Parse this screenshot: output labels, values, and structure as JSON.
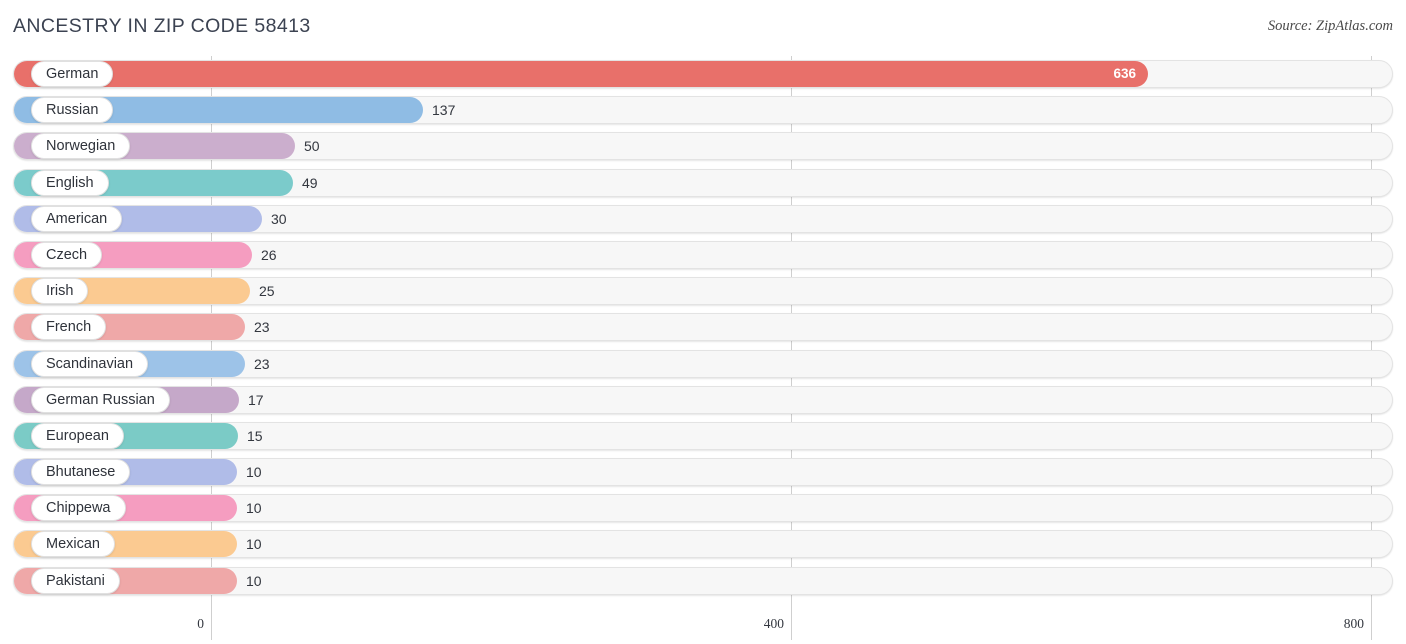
{
  "header": {
    "title": "ANCESTRY IN ZIP CODE 58413",
    "source": "Source: ZipAtlas.com"
  },
  "chart_data": {
    "type": "bar",
    "orientation": "horizontal",
    "title": "ANCESTRY IN ZIP CODE 58413",
    "xlabel": "",
    "ylabel": "",
    "xlim": [
      0,
      800
    ],
    "grid": true,
    "legend": "none",
    "xticks": [
      0,
      400,
      800
    ],
    "xtick_labels": [
      "0",
      "400",
      "800"
    ],
    "categories": [
      "German",
      "Russian",
      "Norwegian",
      "English",
      "American",
      "Czech",
      "Irish",
      "French",
      "Scandinavian",
      "German Russian",
      "European",
      "Bhutanese",
      "Chippewa",
      "Mexican",
      "Pakistani"
    ],
    "values": [
      636,
      137,
      50,
      49,
      30,
      26,
      25,
      23,
      23,
      17,
      15,
      10,
      10,
      10,
      10
    ],
    "value_labels": [
      "636",
      "137",
      "50",
      "49",
      "30",
      "26",
      "25",
      "23",
      "23",
      "17",
      "15",
      "10",
      "10",
      "10",
      "10"
    ],
    "colors": [
      "#E8706A",
      "#8FBCE4",
      "#CBAECD",
      "#7BCBCB",
      "#B0BCE8",
      "#F59DC0",
      "#FBCA91",
      "#EFA8A8",
      "#9DC3E8",
      "#C5A8C9",
      "#7BCBC6",
      "#B0BCE8",
      "#F59DC0",
      "#FBCA91",
      "#EFA8A8"
    ],
    "bar_pixel_ends": [
      1148,
      423,
      295,
      293,
      262,
      252,
      250,
      245,
      245,
      239,
      238,
      237,
      237,
      237,
      237
    ],
    "label_inside_bar": [
      true,
      false,
      false,
      false,
      false,
      false,
      false,
      false,
      false,
      false,
      false,
      false,
      false,
      false,
      false
    ]
  }
}
